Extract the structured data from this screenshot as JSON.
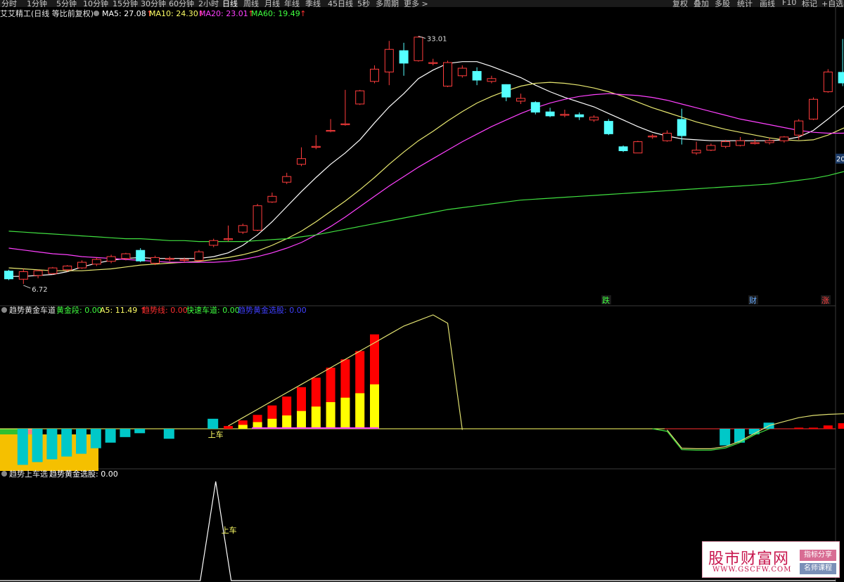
{
  "toolbar": {
    "periods": [
      "分时",
      "1分钟",
      "5分钟",
      "10分钟",
      "15分钟",
      "30分钟",
      "60分钟",
      "2小时",
      "日线",
      "周线",
      "月线",
      "年线",
      "季线",
      "45日线",
      "5秒",
      "多周期",
      "更多 >"
    ],
    "active_period": "日线",
    "tools": [
      "复权",
      "叠加",
      "多股",
      "统计",
      "画线",
      "F10",
      "标记",
      "+自选"
    ]
  },
  "main_panel": {
    "title": "艾艾精工(日线 等比前复权)",
    "indicators": [
      {
        "label": "MA5: 27.08",
        "arrow": "↑",
        "color": "#ffffff"
      },
      {
        "label": "MA10: 24.30",
        "arrow": "↑",
        "color": "#ffff66"
      },
      {
        "label": "MA20: 23.01",
        "arrow": "↑",
        "color": "#ff40ff"
      },
      {
        "label": "MA60: 19.49",
        "arrow": "↑",
        "color": "#40ff40"
      }
    ],
    "high_label": "33.01",
    "low_label": "6.72",
    "axis_tag": "20",
    "markers": [
      {
        "text": "跌",
        "color": "#40ff40"
      },
      {
        "text": "财",
        "color": "#66aaff"
      },
      {
        "text": "涨",
        "color": "#ff4040"
      }
    ]
  },
  "panel2": {
    "title": "趋势黄金车道",
    "indicators": [
      {
        "label": "黄金段: 0.00",
        "color": "#40ff40"
      },
      {
        "label": "A5: 11.49",
        "arrow": "↑",
        "color": "#ffff66"
      },
      {
        "label": "趋势线: 0.00",
        "color": "#ff3030"
      },
      {
        "label": "快速车道: 0.00",
        "color": "#40ff40"
      },
      {
        "label": "趋势黄金选股: 0.00",
        "color": "#4040ff"
      }
    ],
    "signal_label": "上车"
  },
  "panel3": {
    "title": "趋势上车选",
    "indicators": [
      {
        "label": "趋势黄金选股: 0.00",
        "color": "#ffffff"
      }
    ],
    "signal_label": "上车"
  },
  "watermark": {
    "name": "股市财富网",
    "url": "WWW.GSCFW.COM",
    "badge1": "指标分享",
    "badge2": "名师课程"
  },
  "colors": {
    "up": "#ff3c3c",
    "down": "#54ffff",
    "ma5": "#ffffff",
    "ma10": "#e8e870",
    "ma20": "#ff40ff",
    "ma60": "#40e040",
    "bar_red": "#ff0000",
    "bar_yellow": "#ffff00",
    "bar_cyan": "#00c8c8"
  },
  "chart_data": {
    "type": "candlestick",
    "price_range": [
      5.5,
      35.2
    ],
    "candles": [
      [
        8.1,
        7.2,
        8.2,
        7.1
      ],
      [
        7.2,
        8.0,
        8.3,
        6.7
      ],
      [
        7.6,
        8.1,
        8.2,
        7.3
      ],
      [
        7.8,
        8.4,
        8.5,
        7.7
      ],
      [
        8.2,
        8.6,
        8.7,
        8.0
      ],
      [
        8.4,
        9.0,
        9.2,
        8.3
      ],
      [
        8.8,
        9.3,
        9.5,
        8.6
      ],
      [
        9.1,
        9.6,
        9.8,
        8.9
      ],
      [
        9.4,
        9.9,
        10.0,
        9.2
      ],
      [
        10.3,
        9.1,
        10.5,
        9.0
      ],
      [
        8.9,
        9.5,
        9.7,
        8.7
      ],
      [
        9.3,
        9.4,
        9.6,
        9.1
      ],
      [
        9.2,
        9.3,
        9.5,
        9.0
      ],
      [
        9.2,
        10.1,
        10.3,
        9.1
      ],
      [
        10.8,
        11.3,
        11.5,
        10.6
      ],
      [
        11.4,
        11.5,
        12.9,
        11.2
      ],
      [
        12.2,
        12.9,
        13.1,
        12.0
      ],
      [
        12.4,
        15.0,
        15.2,
        12.3
      ],
      [
        15.4,
        16.0,
        16.4,
        15.3
      ],
      [
        17.5,
        18.1,
        18.5,
        17.3
      ],
      [
        19.4,
        20.0,
        21.2,
        19.2
      ],
      [
        21.2,
        21.3,
        22.5,
        21.0
      ],
      [
        22.9,
        23.0,
        24.2,
        22.8
      ],
      [
        23.6,
        23.7,
        27.3,
        23.5
      ],
      [
        25.8,
        27.2,
        27.3,
        25.7
      ],
      [
        28.2,
        29.5,
        29.9,
        28.0
      ],
      [
        29.2,
        31.6,
        32.5,
        27.8
      ],
      [
        31.5,
        30.1,
        32.3,
        28.8
      ],
      [
        30.4,
        32.9,
        33.0,
        30.3
      ],
      [
        30.1,
        30.2,
        30.6,
        29.9
      ],
      [
        27.7,
        30.2,
        30.4,
        27.6
      ],
      [
        28.8,
        29.6,
        29.9,
        28.6
      ],
      [
        29.3,
        28.3,
        29.7,
        27.8
      ],
      [
        28.2,
        28.5,
        28.8,
        28.0
      ],
      [
        27.9,
        26.5,
        27.9,
        26.1
      ],
      [
        26.1,
        26.4,
        26.9,
        25.8
      ],
      [
        26.0,
        24.9,
        26.1,
        24.7
      ],
      [
        25.0,
        24.5,
        25.4,
        24.4
      ],
      [
        24.6,
        24.7,
        25.2,
        24.4
      ],
      [
        24.7,
        24.4,
        24.9,
        24.1
      ],
      [
        24.1,
        24.4,
        24.6,
        23.9
      ],
      [
        24.0,
        22.6,
        24.2,
        22.5
      ],
      [
        21.3,
        20.8,
        21.4,
        20.7
      ],
      [
        20.6,
        21.8,
        21.9,
        20.6
      ],
      [
        22.3,
        22.4,
        22.6,
        22.1
      ],
      [
        21.9,
        22.7,
        23.0,
        21.8
      ],
      [
        24.2,
        22.4,
        25.3,
        21.5
      ],
      [
        20.6,
        20.9,
        21.8,
        20.4
      ],
      [
        20.9,
        21.4,
        21.6,
        20.8
      ],
      [
        21.3,
        21.8,
        22.0,
        21.1
      ],
      [
        21.4,
        21.9,
        22.3,
        21.3
      ],
      [
        21.6,
        21.7,
        22.1,
        21.5
      ],
      [
        21.7,
        21.9,
        22.2,
        21.5
      ],
      [
        21.9,
        22.3,
        22.4,
        21.7
      ],
      [
        22.5,
        24.0,
        24.2,
        22.0
      ],
      [
        24.2,
        26.3,
        26.5,
        24.1
      ],
      [
        27.1,
        29.2,
        29.5,
        27.0
      ],
      [
        29.2,
        28.0,
        32.7,
        27.7
      ],
      [
        26.3,
        27.9,
        28.1,
        26.1
      ],
      [
        26.7,
        29.3,
        29.5,
        26.6
      ]
    ],
    "series": [
      {
        "name": "MA5",
        "values": [
          7.5,
          7.5,
          7.6,
          7.7,
          8.0,
          8.5,
          8.9,
          9.2,
          9.4,
          9.5,
          9.4,
          9.4,
          9.4,
          9.4,
          9.6,
          10.0,
          10.8,
          11.9,
          13.3,
          14.9,
          16.5,
          18.0,
          19.4,
          20.6,
          22.0,
          23.8,
          25.5,
          26.9,
          28.5,
          29.4,
          30.1,
          30.3,
          30.3,
          29.8,
          29.2,
          28.6,
          27.8,
          27.1,
          26.5,
          26.0,
          25.5,
          24.8,
          24.1,
          23.4,
          22.8,
          22.4,
          22.1,
          22.0,
          21.9,
          21.9,
          21.9,
          21.9,
          21.9,
          22.0,
          22.3,
          23.0,
          24.2,
          25.5,
          26.4,
          27.1
        ]
      },
      {
        "name": "MA10",
        "values": [
          8.4,
          8.3,
          8.2,
          8.1,
          8.1,
          8.1,
          8.2,
          8.3,
          8.5,
          8.7,
          8.8,
          8.9,
          9.0,
          9.1,
          9.3,
          9.5,
          9.8,
          10.2,
          10.8,
          11.5,
          12.3,
          13.3,
          14.4,
          15.5,
          16.7,
          18.0,
          19.4,
          20.7,
          21.9,
          22.9,
          24.0,
          25.0,
          25.9,
          26.6,
          27.2,
          27.7,
          28.0,
          28.1,
          28.0,
          27.8,
          27.5,
          27.1,
          26.6,
          26.0,
          25.4,
          24.9,
          24.4,
          23.9,
          23.5,
          23.1,
          22.8,
          22.5,
          22.2,
          22.0,
          21.9,
          22.0,
          22.5,
          23.2,
          23.8,
          24.3
        ]
      },
      {
        "name": "MA20",
        "values": [
          10.5,
          10.3,
          10.1,
          9.9,
          9.8,
          9.6,
          9.5,
          9.4,
          9.3,
          9.2,
          9.1,
          9.0,
          9.0,
          9.0,
          9.0,
          9.1,
          9.3,
          9.6,
          10.0,
          10.5,
          11.1,
          11.9,
          12.8,
          13.8,
          14.9,
          16.0,
          17.1,
          18.1,
          19.1,
          20.0,
          20.9,
          21.8,
          22.6,
          23.4,
          24.1,
          24.8,
          25.4,
          25.9,
          26.3,
          26.6,
          26.8,
          26.9,
          26.8,
          26.7,
          26.5,
          26.2,
          25.8,
          25.4,
          25.0,
          24.6,
          24.2,
          23.9,
          23.6,
          23.3,
          23.0,
          22.8,
          22.7,
          22.7,
          22.8,
          23.0
        ]
      },
      {
        "name": "MA60",
        "values": [
          12.3,
          12.2,
          12.1,
          12.0,
          11.9,
          11.8,
          11.7,
          11.6,
          11.5,
          11.5,
          11.4,
          11.3,
          11.3,
          11.2,
          11.2,
          11.2,
          11.2,
          11.3,
          11.4,
          11.5,
          11.7,
          11.9,
          12.2,
          12.5,
          12.8,
          13.1,
          13.4,
          13.7,
          14.0,
          14.3,
          14.6,
          14.8,
          15.0,
          15.2,
          15.4,
          15.6,
          15.7,
          15.8,
          15.9,
          16.0,
          16.1,
          16.2,
          16.3,
          16.4,
          16.5,
          16.6,
          16.7,
          16.8,
          16.9,
          17.0,
          17.1,
          17.2,
          17.3,
          17.5,
          17.7,
          17.9,
          18.2,
          18.6,
          19.0,
          19.5
        ]
      },
      {
        "name": "A5",
        "values": [
          null,
          null,
          null,
          null,
          null,
          null,
          null,
          null,
          null,
          null,
          null,
          null,
          null,
          null,
          null,
          0.5,
          2,
          3.5,
          5,
          6.5,
          8,
          9.5,
          11,
          12.5,
          14,
          15.5,
          17,
          18.5,
          19.5,
          20.5,
          19,
          -0.2,
          null,
          null,
          null,
          null,
          null,
          null,
          null,
          null,
          null,
          null,
          null,
          null,
          null,
          -0.2,
          -3.5,
          -3.6,
          -3.6,
          -3.2,
          -2.2,
          -0.8,
          0.6,
          1.3,
          2,
          2.4,
          2.6,
          2.7,
          2.7,
          2.8
        ]
      }
    ],
    "bars_red": [
      null,
      null,
      null,
      null,
      null,
      null,
      null,
      null,
      null,
      null,
      null,
      null,
      null,
      null,
      null,
      0.5,
      1.5,
      2.5,
      4.2,
      5.8,
      7.5,
      9.2,
      11.0,
      12.5,
      14.0,
      17.0,
      null,
      null,
      null,
      null,
      null,
      null,
      null,
      null,
      null,
      null,
      null,
      null,
      null,
      null,
      null,
      null,
      null,
      null,
      null,
      null,
      null,
      null,
      null,
      null,
      null,
      null,
      null,
      null,
      0.2,
      0.2,
      0.6,
      1.0,
      1.2,
      1.6
    ],
    "bars_yellow": [
      null,
      null,
      null,
      null,
      null,
      null,
      null,
      null,
      null,
      null,
      null,
      null,
      null,
      null,
      null,
      null,
      0.7,
      1.2,
      1.8,
      2.4,
      3.2,
      4.0,
      4.8,
      5.6,
      6.4,
      8.0,
      null,
      null,
      null,
      null,
      null,
      null,
      null,
      null,
      null,
      null,
      null,
      null,
      null,
      null,
      null,
      null,
      null,
      null,
      null,
      null,
      null,
      null,
      null,
      null,
      null,
      null,
      null,
      null,
      null,
      null,
      null,
      null,
      null,
      null
    ],
    "bars_cyan": [
      null,
      -6.5,
      -6.0,
      -5.5,
      -5.0,
      -4.5,
      -3.5,
      -2.5,
      -1.5,
      -0.8,
      null,
      -1.8,
      null,
      null,
      1.8,
      null,
      null,
      null,
      null,
      null,
      null,
      null,
      null,
      null,
      null,
      null,
      null,
      null,
      null,
      null,
      null,
      null,
      null,
      null,
      null,
      null,
      null,
      null,
      null,
      null,
      null,
      null,
      null,
      null,
      null,
      null,
      null,
      null,
      null,
      -3.0,
      -2.5,
      -1.0,
      1.1,
      null,
      null,
      null,
      null,
      null,
      null,
      null
    ],
    "signal_days": [
      14
    ]
  }
}
